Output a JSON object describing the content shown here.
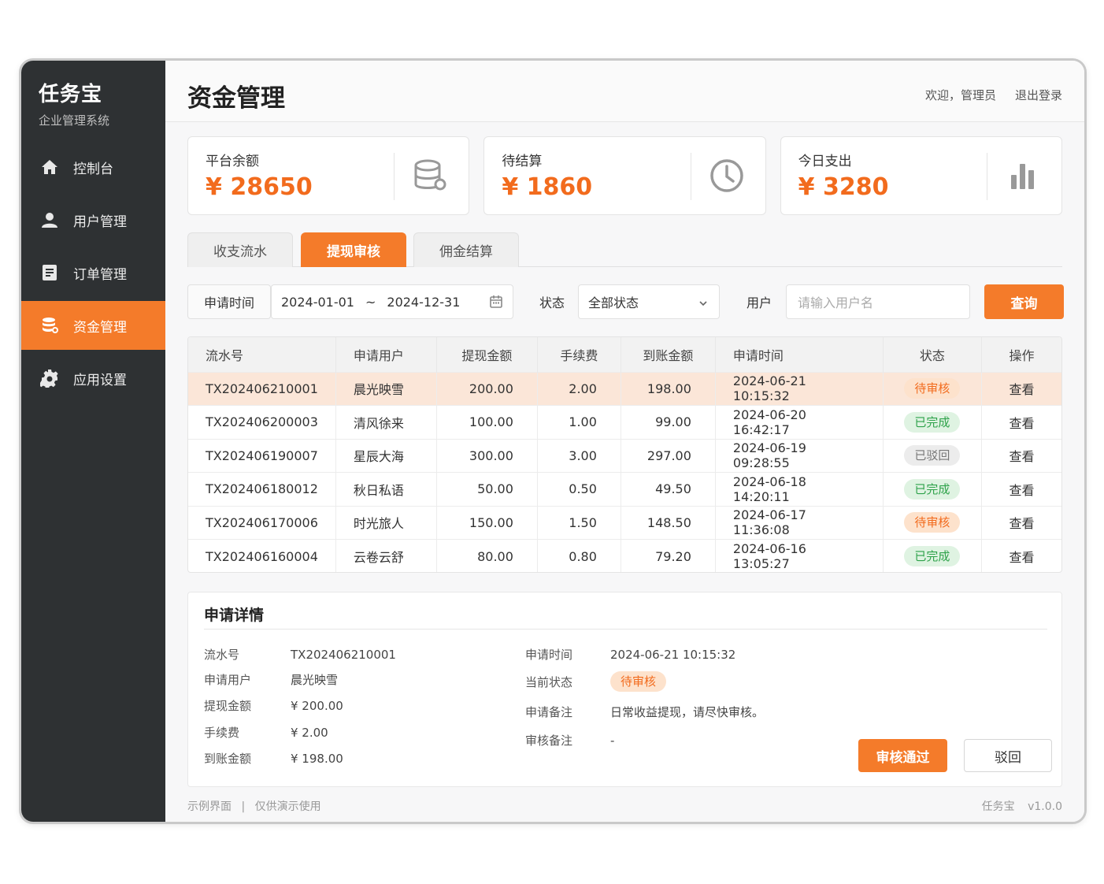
{
  "brand": {
    "title": "任务宝",
    "subtitle": "企业管理系统"
  },
  "sidebar": {
    "items": [
      {
        "label": "控制台",
        "icon": "home-icon",
        "active": false
      },
      {
        "label": "用户管理",
        "icon": "user-icon",
        "active": false
      },
      {
        "label": "订单管理",
        "icon": "document-icon",
        "active": false
      },
      {
        "label": "资金管理",
        "icon": "database-icon",
        "active": true
      },
      {
        "label": "应用设置",
        "icon": "gear-icon",
        "active": false
      }
    ]
  },
  "header": {
    "title": "资金管理",
    "welcome": "欢迎，管理员",
    "logout": "退出登录"
  },
  "cards": [
    {
      "label": "平台余额",
      "value": "¥ 28650",
      "icon": "database-icon"
    },
    {
      "label": "待结算",
      "value": "¥ 1860",
      "icon": "clock-icon"
    },
    {
      "label": "今日支出",
      "value": "¥ 3280",
      "icon": "bar-chart-icon"
    }
  ],
  "tabs": [
    {
      "label": "收支流水",
      "active": false
    },
    {
      "label": "提现审核",
      "active": true
    },
    {
      "label": "佣金结算",
      "active": false
    }
  ],
  "filters": {
    "date_label": "申请时间",
    "date_start": "2024-01-01",
    "date_sep": "~",
    "date_end": "2024-12-31",
    "status_label": "状态",
    "status_value": "全部状态",
    "user_label": "用户",
    "user_placeholder": "请输入用户名",
    "query_button": "查询"
  },
  "table": {
    "headers": [
      "流水号",
      "申请用户",
      "提现金额",
      "手续费",
      "到账金额",
      "申请时间",
      "状态",
      "操作"
    ],
    "rows": [
      {
        "id": "TX202406210001",
        "user": "晨光映雪",
        "amount": "200.00",
        "fee": "2.00",
        "received": "198.00",
        "time": "2024-06-21 10:15:32",
        "status": "待审核",
        "action": "查看"
      },
      {
        "id": "TX202406200003",
        "user": "清风徐来",
        "amount": "100.00",
        "fee": "1.00",
        "received": "99.00",
        "time": "2024-06-20 16:42:17",
        "status": "已完成",
        "action": "查看"
      },
      {
        "id": "TX202406190007",
        "user": "星辰大海",
        "amount": "300.00",
        "fee": "3.00",
        "received": "297.00",
        "time": "2024-06-19 09:28:55",
        "status": "已驳回",
        "action": "查看"
      },
      {
        "id": "TX202406180012",
        "user": "秋日私语",
        "amount": "50.00",
        "fee": "0.50",
        "received": "49.50",
        "time": "2024-06-18 14:20:11",
        "status": "已完成",
        "action": "查看"
      },
      {
        "id": "TX202406170006",
        "user": "时光旅人",
        "amount": "150.00",
        "fee": "1.50",
        "received": "148.50",
        "time": "2024-06-17 11:36:08",
        "status": "待审核",
        "action": "查看"
      },
      {
        "id": "TX202406160004",
        "user": "云卷云舒",
        "amount": "80.00",
        "fee": "0.80",
        "received": "79.20",
        "time": "2024-06-16 13:05:27",
        "status": "已完成",
        "action": "查看"
      }
    ]
  },
  "detail": {
    "title": "申请详情",
    "left": [
      {
        "key": "流水号",
        "value": "TX202406210001"
      },
      {
        "key": "申请用户",
        "value": "晨光映雪"
      },
      {
        "key": "提现金额",
        "value": "¥ 200.00"
      },
      {
        "key": "手续费",
        "value": "¥ 2.00"
      },
      {
        "key": "到账金额",
        "value": "¥ 198.00"
      }
    ],
    "right": [
      {
        "key": "申请时间",
        "value": "2024-06-21 10:15:32"
      },
      {
        "key": "当前状态",
        "value": "待审核"
      },
      {
        "key": "申请备注",
        "value": "日常收益提现，请尽快审核。"
      },
      {
        "key": "审核备注",
        "value": "-"
      }
    ],
    "approve_button": "审核通过",
    "reject_button": "驳回"
  },
  "footer": {
    "left_a": "示例界面",
    "sep": "|",
    "left_b": "仅供演示使用",
    "right_a": "任务宝",
    "right_b": "v1.0.0"
  },
  "colors": {
    "accent": "#f47b2a",
    "sidebar": "#2e3133",
    "success": "#2ea24a",
    "pending": "#f26b1d"
  }
}
